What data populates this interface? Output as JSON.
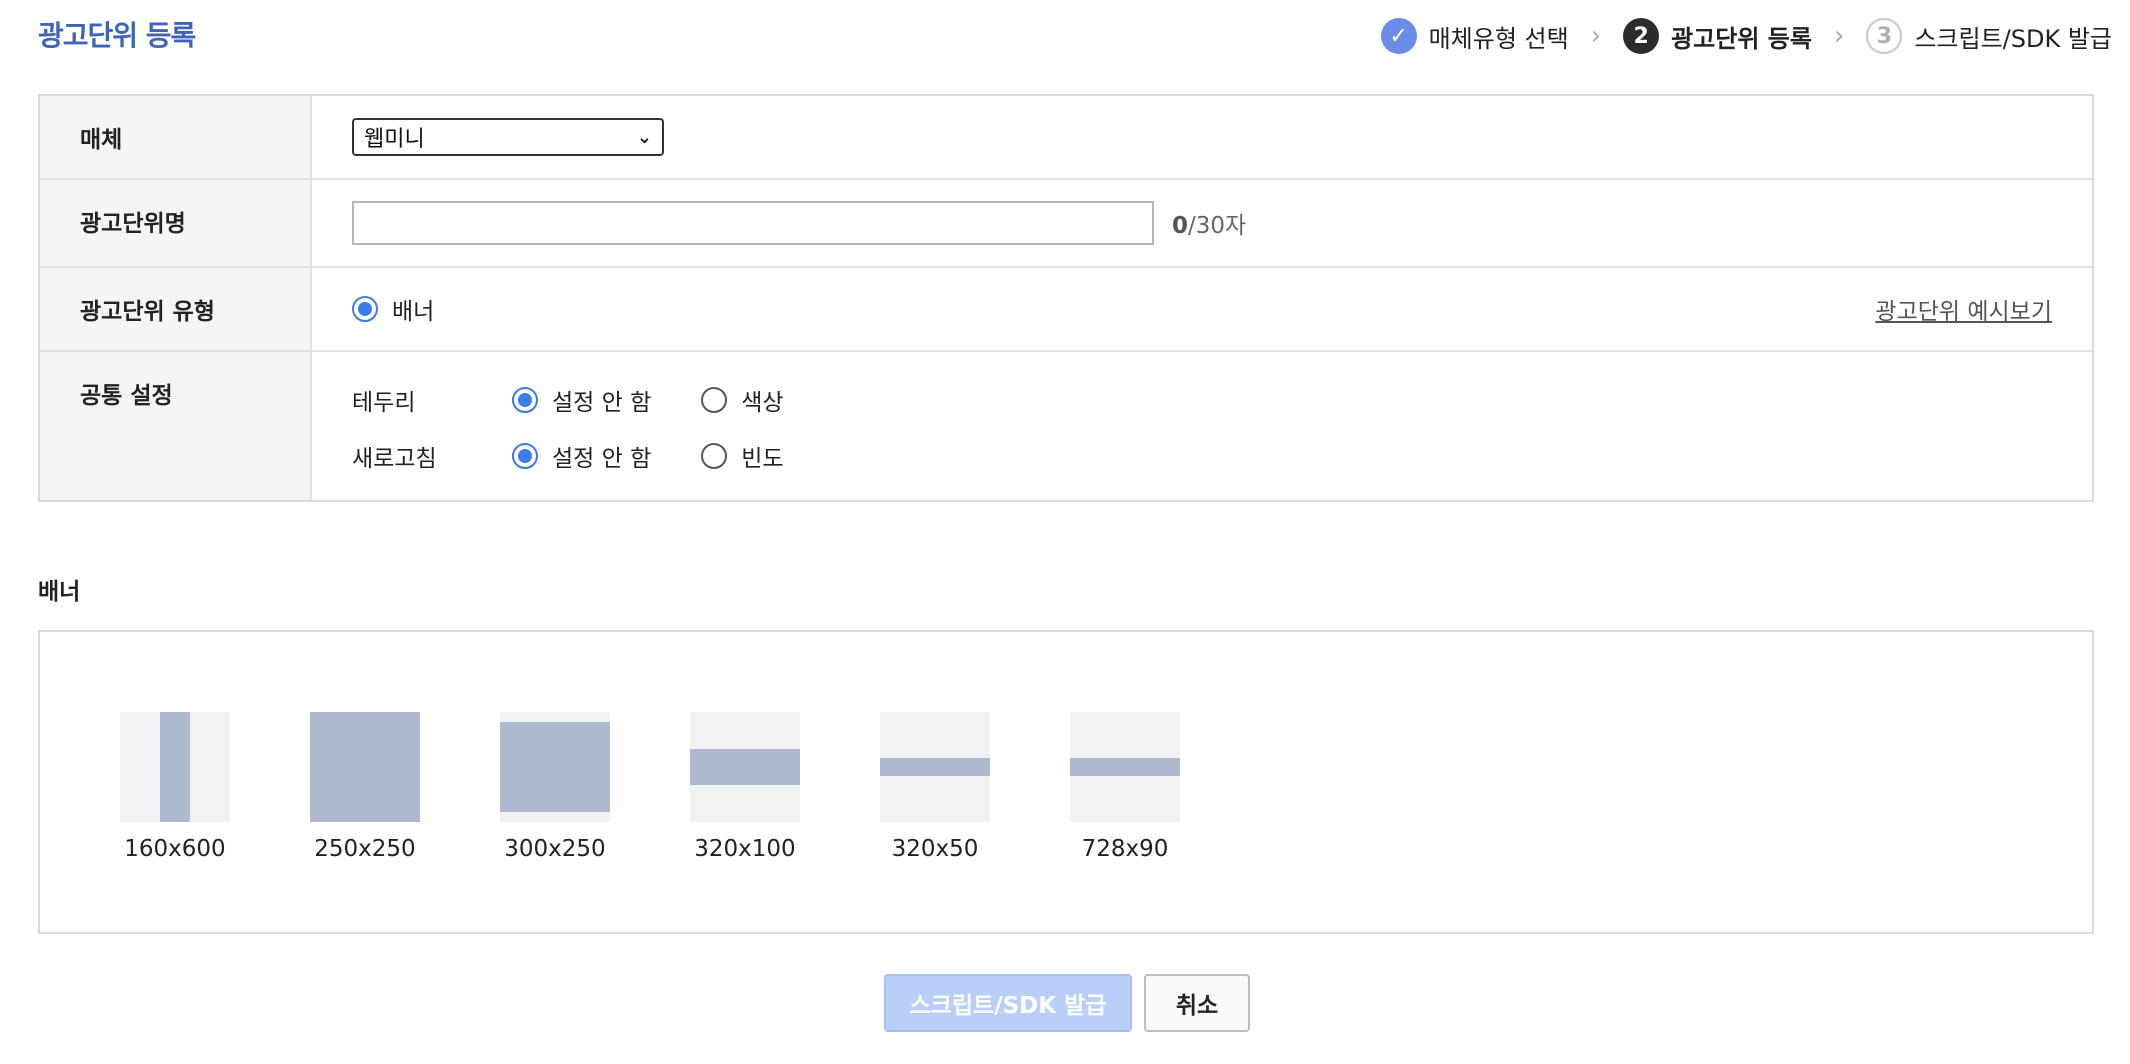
{
  "header": {
    "title": "광고단위 등록",
    "steps": [
      {
        "number": "✓",
        "label": "매체유형 선택",
        "state": "done"
      },
      {
        "number": "2",
        "label": "광고단위 등록",
        "state": "current"
      },
      {
        "number": "3",
        "label": "스크립트/SDK 발급",
        "state": "todo"
      }
    ],
    "separator": "›"
  },
  "form": {
    "media": {
      "label": "매체",
      "selected": "웹미니"
    },
    "ad_unit_name": {
      "label": "광고단위명",
      "value": "",
      "count": "0",
      "max": "/30자"
    },
    "ad_unit_type": {
      "label": "광고단위 유형",
      "option": "배너",
      "preview_link": "광고단위 예시보기"
    },
    "common": {
      "label": "공통 설정",
      "border": {
        "label": "테두리",
        "opt1": "설정 안 함",
        "opt2": "색상"
      },
      "refresh": {
        "label": "새로고침",
        "opt1": "설정 안 함",
        "opt2": "빈도"
      }
    }
  },
  "banner": {
    "title": "배너",
    "sizes": [
      "160x600",
      "250x250",
      "300x250",
      "320x100",
      "320x50",
      "728x90"
    ]
  },
  "buttons": {
    "issue": "스크립트/SDK 발급",
    "cancel": "취소"
  },
  "colors": {
    "accent": "#3b7ce6",
    "title": "#3e63b8",
    "disabled_button": "#b9cff8",
    "banner_fill": "#aeb9cf"
  }
}
